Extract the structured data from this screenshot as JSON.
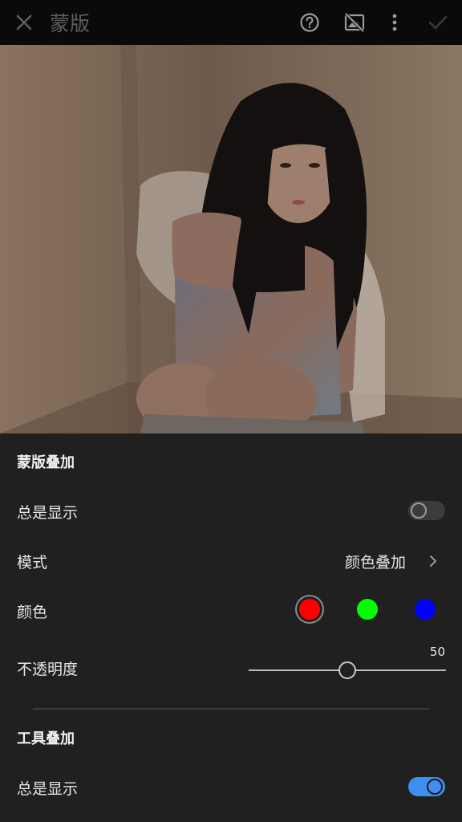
{
  "header": {
    "title": "蒙版",
    "icons": [
      "close-icon",
      "help-icon",
      "mask-hide-icon",
      "more-icon",
      "check-icon"
    ]
  },
  "mask_overlay": {
    "section_title": "蒙版叠加",
    "always_show_label": "总是显示",
    "always_show_on": false,
    "mode_label": "模式",
    "mode_value": "颜色叠加",
    "color_label": "颜色",
    "colors": [
      "#ff0000",
      "#00ff00",
      "#0000ff"
    ],
    "selected_color": "#ff0000",
    "opacity_label": "不透明度",
    "opacity_value": "50",
    "opacity_fraction": 0.5
  },
  "tool_overlay": {
    "section_title": "工具叠加",
    "always_show_label": "总是显示",
    "always_show_on": true
  }
}
